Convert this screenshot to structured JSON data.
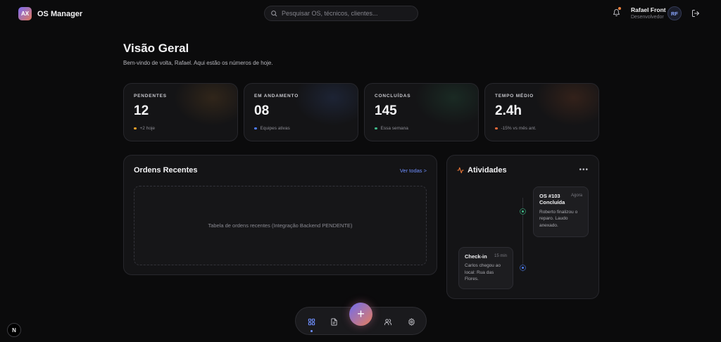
{
  "header": {
    "logo_text": "AX",
    "app_name": "OS Manager",
    "search_placeholder": "Pesquisar OS, técnicos, clientes...",
    "user_name": "Rafael Front",
    "user_role": "Desenvolvedor",
    "avatar_initials": "RF",
    "notification_dot_color": "#f2833d"
  },
  "intro": {
    "title": "Visão Geral",
    "subtitle": "Bem-vindo de volta, Rafael. Aqui estão os números de hoje."
  },
  "stats": [
    {
      "label": "PENDENTES",
      "value": "12",
      "note": "+2 hoje",
      "dot_color": "#f0a12a"
    },
    {
      "label": "EM ANDAMENTO",
      "value": "08",
      "note": "Equipes ativas",
      "dot_color": "#4f7dff"
    },
    {
      "label": "CONCLUÍDAS",
      "value": "145",
      "note": "Essa semana",
      "dot_color": "#3fb98a"
    },
    {
      "label": "TEMPO MÉDIO",
      "value": "2.4h",
      "note": "-15% vs mês ant.",
      "dot_color": "#f06a3a"
    }
  ],
  "recent_orders": {
    "title": "Ordens Recentes",
    "view_all": "Ver todas >",
    "placeholder": "Tabela de ordens recentes (Integração Backend PENDENTE)"
  },
  "activities": {
    "title": "Atividades",
    "more": "•••",
    "items": [
      {
        "title": "OS #103 Concluída",
        "time": "Agora",
        "desc": "Roberto finalizou o reparo. Laudo anexado.",
        "dot_color": "#3fb98a"
      },
      {
        "title": "Check-in",
        "time": "15 min",
        "desc": "Carlos chegou ao local: Rua das Flores.",
        "dot_color": "#4f7dff"
      }
    ]
  },
  "dock": {
    "fab_label": "+"
  },
  "dev_badge": "N"
}
